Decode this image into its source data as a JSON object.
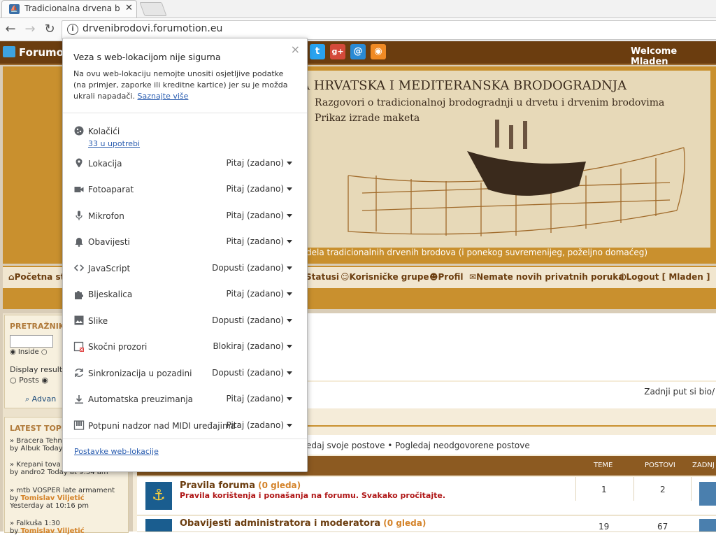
{
  "browser": {
    "tab_title": "Tradicionalna drvena bro",
    "tab_close": "✕",
    "url": "drvenibrodovi.forumotion.eu"
  },
  "forumotion": {
    "brand": "Forumoti",
    "welcome": "Welcome Mladen"
  },
  "banner": {
    "title": "A HRVATSKA I MEDITERANSKA BRODOGRADNJA",
    "line1": "Razgovori o tradicionalnoj brodogradnji u drvetu i drvenim brodovima",
    "line2": "Prikaz izrade maketa",
    "subtitle": "dela tradicionalnih drvenih brodova (i ponekog suvremenijeg, poželjno domaćeg)"
  },
  "nav": {
    "home": "Početna st",
    "statusi": "Statusi",
    "groups": "Korisničke grupe",
    "profile": "Profil",
    "messages": "Nemate novih privatnih poruka",
    "logout": "Logout [ Mladen ]"
  },
  "sidebar": {
    "search_title": "PRETRAŽNIK",
    "inside": "Inside",
    "display_results": "Display result",
    "posts": "Posts",
    "advanced": "Advan",
    "latest_title": "LATEST TOPI",
    "topics": [
      {
        "title": "» Bracera Tehn",
        "meta": "by Albuk Today"
      },
      {
        "title": "» Krepani tova",
        "meta": "by andro2 Today at 9:54 am"
      },
      {
        "title": "» mtb VOSPER late armament",
        "meta_by": "by",
        "meta_user": "Tomislav Viljetić",
        "meta_time": "Yesterday at 10:16 pm"
      },
      {
        "title": "» Falkuša 1:30",
        "meta_by": "by",
        "meta_user": "Tomislav Viljetić"
      }
    ]
  },
  "main": {
    "last_visit": "Zadnji put si bio/",
    "links": "edaj svoje postove • Pogledaj neodgovorene postove",
    "col_topics": "TEME",
    "col_posts": "POSTOVI",
    "col_last": "ZADNJ",
    "forums": [
      {
        "name": "Pravila foruma",
        "views": "(0 gleda)",
        "desc": "Pravila korištenja i ponašanja na forumu. Svakako pročitajte.",
        "topics": "1",
        "posts": "2"
      },
      {
        "name": "Obavijesti administratora i moderatora",
        "views": "(0 gleda)",
        "desc": "",
        "topics": "19",
        "posts": "67"
      }
    ]
  },
  "popup": {
    "close": "×",
    "heading": "Veza s web-lokacijom nije sigurna",
    "warning": "Na ovu web-lokaciju nemojte unositi osjetljive podatke (na primjer, zaporke ili kreditne kartice) jer su je možda ukrali napadači.",
    "learn_more": "Saznajte više",
    "cookies_label": "Kolačići",
    "cookies_link": "33 u upotrebi",
    "permissions": [
      {
        "label": "Lokacija",
        "value": "Pitaj (zadano)",
        "icon": "location-pin-icon"
      },
      {
        "label": "Fotoaparat",
        "value": "Pitaj (zadano)",
        "icon": "camera-icon"
      },
      {
        "label": "Mikrofon",
        "value": "Pitaj (zadano)",
        "icon": "microphone-icon"
      },
      {
        "label": "Obavijesti",
        "value": "Pitaj (zadano)",
        "icon": "bell-icon"
      },
      {
        "label": "JavaScript",
        "value": "Dopusti (zadano)",
        "icon": "code-icon"
      },
      {
        "label": "Bljeskalica",
        "value": "Pitaj (zadano)",
        "icon": "puzzle-icon"
      },
      {
        "label": "Slike",
        "value": "Dopusti (zadano)",
        "icon": "image-icon"
      },
      {
        "label": "Skočni prozori",
        "value": "Blokiraj (zadano)",
        "icon": "popup-blocked-icon"
      },
      {
        "label": "Sinkronizacija u pozadini",
        "value": "Dopusti (zadano)",
        "icon": "sync-icon"
      },
      {
        "label": "Automatska preuzimanja",
        "value": "Pitaj (zadano)",
        "icon": "download-icon"
      },
      {
        "label": "Potpuni nadzor nad MIDI uređajima",
        "value": "Pitaj (zadano)",
        "icon": "midi-piano-icon"
      }
    ],
    "site_settings": "Postavke web-lokacije"
  }
}
